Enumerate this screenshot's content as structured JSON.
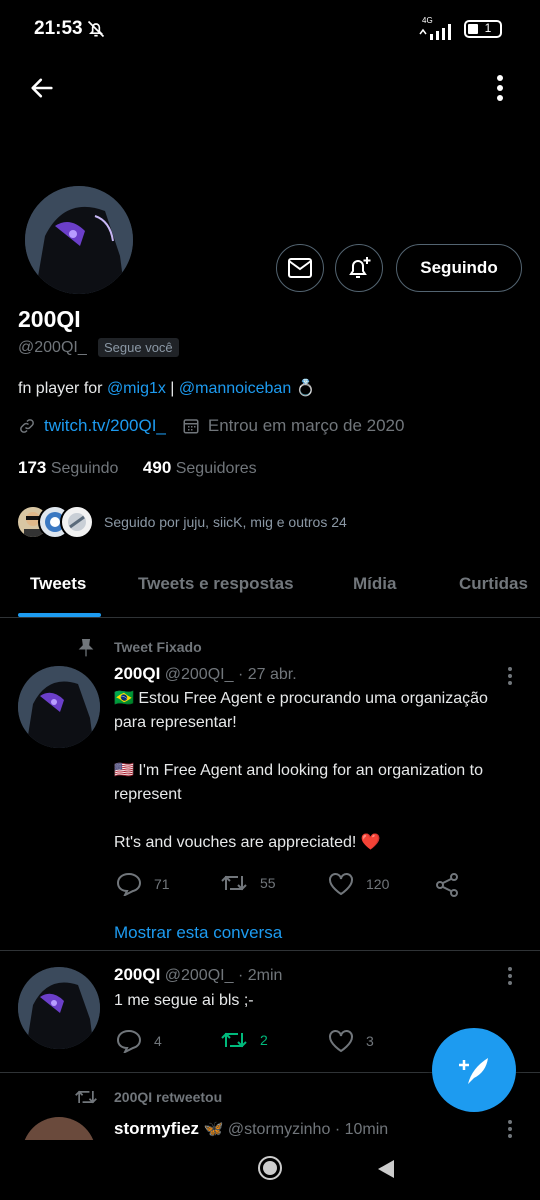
{
  "status_bar": {
    "time": "21:53",
    "network": "4G",
    "battery": "1"
  },
  "profile": {
    "name": "200QI",
    "handle": "@200QI_",
    "follows_you": "Segue você",
    "following_button": "Seguindo",
    "bio_prefix": "fn player for ",
    "bio_mention1": "@mig1x",
    "bio_separator": " | ",
    "bio_mention2": "@mannoiceban",
    "bio_emoji": "💍",
    "link": "twitch.tv/200QI_",
    "joined": "Entrou em março de 2020",
    "following_count": "173",
    "following_label": "Seguindo",
    "followers_count": "490",
    "followers_label": "Seguidores",
    "followed_by": "Seguido por juju, siicK, mig e outros 24"
  },
  "tabs": [
    "Tweets",
    "Tweets e respostas",
    "Mídia",
    "Curtidas"
  ],
  "pinned_label": "Tweet Fixado",
  "tweets": [
    {
      "name": "200QI",
      "handle": "@200QI_",
      "time": "· 27 abr.",
      "para1": "🇧🇷 Estou Free Agent e procurando uma organização para representar!",
      "para2": "🇺🇸 I'm Free Agent and looking for an organization to represent",
      "para3": "Rt's and vouches are appreciated! ❤️",
      "replies": "71",
      "retweets": "55",
      "likes": "120",
      "show_thread": "Mostrar esta conversa"
    },
    {
      "name": "200QI",
      "handle": "@200QI_",
      "time": "· 2min",
      "text": "1 me segue ai bls ;-",
      "replies": "4",
      "retweets": "2",
      "likes": "3"
    }
  ],
  "retweet": {
    "label": "200QI retweetou",
    "name": "stormyfiez",
    "handle": "@stormyzinho",
    "time": "· 10min"
  },
  "colors": {
    "accent": "#1d9bf0",
    "retweet_green": "#00ba7c",
    "heart_red": "#f91880"
  }
}
